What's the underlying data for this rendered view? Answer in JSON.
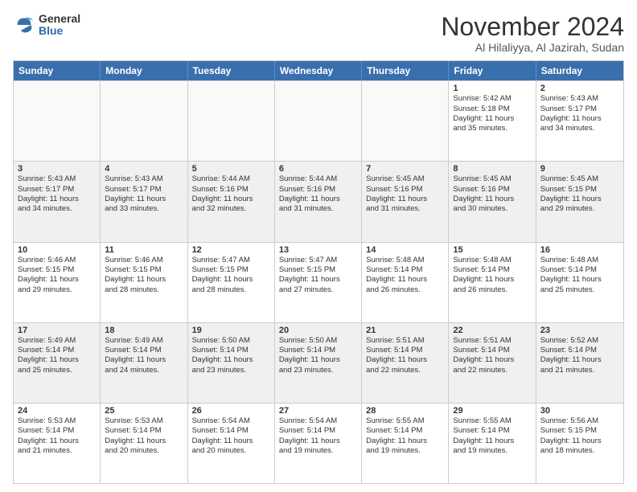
{
  "logo": {
    "general": "General",
    "blue": "Blue"
  },
  "header": {
    "month": "November 2024",
    "location": "Al Hilaliyya, Al Jazirah, Sudan"
  },
  "weekdays": [
    "Sunday",
    "Monday",
    "Tuesday",
    "Wednesday",
    "Thursday",
    "Friday",
    "Saturday"
  ],
  "rows": [
    [
      {
        "day": "",
        "info": "",
        "empty": true
      },
      {
        "day": "",
        "info": "",
        "empty": true
      },
      {
        "day": "",
        "info": "",
        "empty": true
      },
      {
        "day": "",
        "info": "",
        "empty": true
      },
      {
        "day": "",
        "info": "",
        "empty": true
      },
      {
        "day": "1",
        "info": "Sunrise: 5:42 AM\nSunset: 5:18 PM\nDaylight: 11 hours\nand 35 minutes.",
        "empty": false
      },
      {
        "day": "2",
        "info": "Sunrise: 5:43 AM\nSunset: 5:17 PM\nDaylight: 11 hours\nand 34 minutes.",
        "empty": false
      }
    ],
    [
      {
        "day": "3",
        "info": "Sunrise: 5:43 AM\nSunset: 5:17 PM\nDaylight: 11 hours\nand 34 minutes.",
        "empty": false
      },
      {
        "day": "4",
        "info": "Sunrise: 5:43 AM\nSunset: 5:17 PM\nDaylight: 11 hours\nand 33 minutes.",
        "empty": false
      },
      {
        "day": "5",
        "info": "Sunrise: 5:44 AM\nSunset: 5:16 PM\nDaylight: 11 hours\nand 32 minutes.",
        "empty": false
      },
      {
        "day": "6",
        "info": "Sunrise: 5:44 AM\nSunset: 5:16 PM\nDaylight: 11 hours\nand 31 minutes.",
        "empty": false
      },
      {
        "day": "7",
        "info": "Sunrise: 5:45 AM\nSunset: 5:16 PM\nDaylight: 11 hours\nand 31 minutes.",
        "empty": false
      },
      {
        "day": "8",
        "info": "Sunrise: 5:45 AM\nSunset: 5:16 PM\nDaylight: 11 hours\nand 30 minutes.",
        "empty": false
      },
      {
        "day": "9",
        "info": "Sunrise: 5:45 AM\nSunset: 5:15 PM\nDaylight: 11 hours\nand 29 minutes.",
        "empty": false
      }
    ],
    [
      {
        "day": "10",
        "info": "Sunrise: 5:46 AM\nSunset: 5:15 PM\nDaylight: 11 hours\nand 29 minutes.",
        "empty": false
      },
      {
        "day": "11",
        "info": "Sunrise: 5:46 AM\nSunset: 5:15 PM\nDaylight: 11 hours\nand 28 minutes.",
        "empty": false
      },
      {
        "day": "12",
        "info": "Sunrise: 5:47 AM\nSunset: 5:15 PM\nDaylight: 11 hours\nand 28 minutes.",
        "empty": false
      },
      {
        "day": "13",
        "info": "Sunrise: 5:47 AM\nSunset: 5:15 PM\nDaylight: 11 hours\nand 27 minutes.",
        "empty": false
      },
      {
        "day": "14",
        "info": "Sunrise: 5:48 AM\nSunset: 5:14 PM\nDaylight: 11 hours\nand 26 minutes.",
        "empty": false
      },
      {
        "day": "15",
        "info": "Sunrise: 5:48 AM\nSunset: 5:14 PM\nDaylight: 11 hours\nand 26 minutes.",
        "empty": false
      },
      {
        "day": "16",
        "info": "Sunrise: 5:48 AM\nSunset: 5:14 PM\nDaylight: 11 hours\nand 25 minutes.",
        "empty": false
      }
    ],
    [
      {
        "day": "17",
        "info": "Sunrise: 5:49 AM\nSunset: 5:14 PM\nDaylight: 11 hours\nand 25 minutes.",
        "empty": false
      },
      {
        "day": "18",
        "info": "Sunrise: 5:49 AM\nSunset: 5:14 PM\nDaylight: 11 hours\nand 24 minutes.",
        "empty": false
      },
      {
        "day": "19",
        "info": "Sunrise: 5:50 AM\nSunset: 5:14 PM\nDaylight: 11 hours\nand 23 minutes.",
        "empty": false
      },
      {
        "day": "20",
        "info": "Sunrise: 5:50 AM\nSunset: 5:14 PM\nDaylight: 11 hours\nand 23 minutes.",
        "empty": false
      },
      {
        "day": "21",
        "info": "Sunrise: 5:51 AM\nSunset: 5:14 PM\nDaylight: 11 hours\nand 22 minutes.",
        "empty": false
      },
      {
        "day": "22",
        "info": "Sunrise: 5:51 AM\nSunset: 5:14 PM\nDaylight: 11 hours\nand 22 minutes.",
        "empty": false
      },
      {
        "day": "23",
        "info": "Sunrise: 5:52 AM\nSunset: 5:14 PM\nDaylight: 11 hours\nand 21 minutes.",
        "empty": false
      }
    ],
    [
      {
        "day": "24",
        "info": "Sunrise: 5:53 AM\nSunset: 5:14 PM\nDaylight: 11 hours\nand 21 minutes.",
        "empty": false
      },
      {
        "day": "25",
        "info": "Sunrise: 5:53 AM\nSunset: 5:14 PM\nDaylight: 11 hours\nand 20 minutes.",
        "empty": false
      },
      {
        "day": "26",
        "info": "Sunrise: 5:54 AM\nSunset: 5:14 PM\nDaylight: 11 hours\nand 20 minutes.",
        "empty": false
      },
      {
        "day": "27",
        "info": "Sunrise: 5:54 AM\nSunset: 5:14 PM\nDaylight: 11 hours\nand 19 minutes.",
        "empty": false
      },
      {
        "day": "28",
        "info": "Sunrise: 5:55 AM\nSunset: 5:14 PM\nDaylight: 11 hours\nand 19 minutes.",
        "empty": false
      },
      {
        "day": "29",
        "info": "Sunrise: 5:55 AM\nSunset: 5:14 PM\nDaylight: 11 hours\nand 19 minutes.",
        "empty": false
      },
      {
        "day": "30",
        "info": "Sunrise: 5:56 AM\nSunset: 5:15 PM\nDaylight: 11 hours\nand 18 minutes.",
        "empty": false
      }
    ]
  ]
}
